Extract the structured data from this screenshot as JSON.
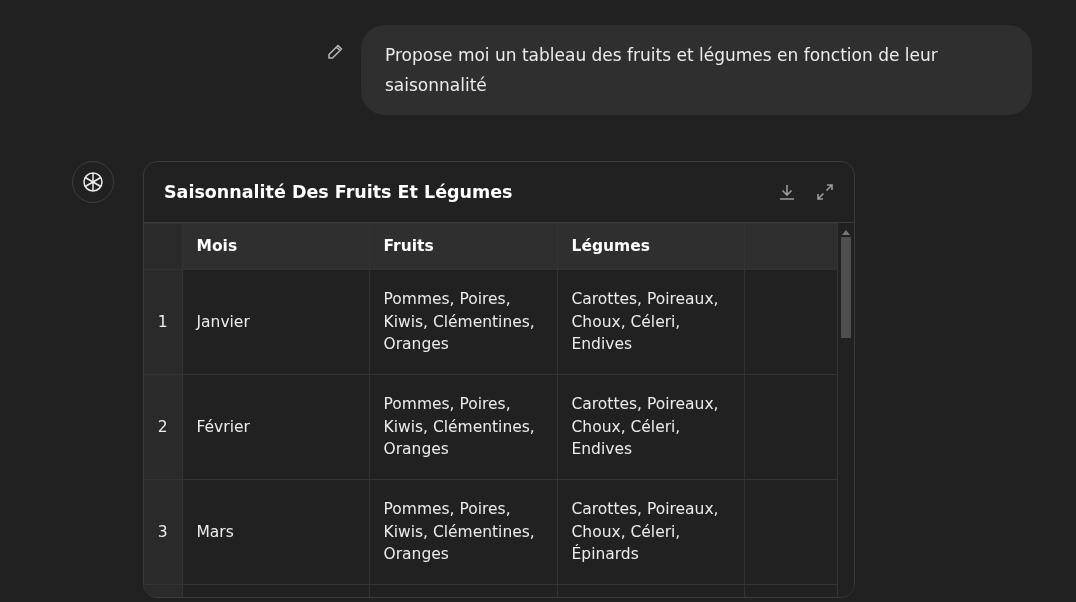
{
  "user_message": {
    "text": "Propose moi un tableau des fruits et légumes en fonction de leur saisonnalité"
  },
  "table_card": {
    "title": "Saisonnalité Des Fruits Et Légumes",
    "columns": [
      "Mois",
      "Fruits",
      "Légumes"
    ],
    "rows": [
      {
        "index": "1",
        "cells": [
          "Janvier",
          "Pommes, Poires, Kiwis, Clémentines, Oranges",
          "Carottes, Poireaux, Choux, Céleri, Endives"
        ]
      },
      {
        "index": "2",
        "cells": [
          "Février",
          "Pommes, Poires, Kiwis, Clémentines, Oranges",
          "Carottes, Poireaux, Choux, Céleri, Endives"
        ]
      },
      {
        "index": "3",
        "cells": [
          "Mars",
          "Pommes, Poires, Kiwis, Clémentines, Oranges",
          "Carottes, Poireaux, Choux, Céleri, Épinards"
        ]
      }
    ]
  }
}
